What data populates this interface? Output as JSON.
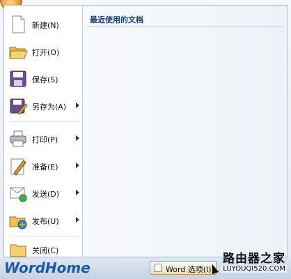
{
  "recent": {
    "title": "最近使用的文档"
  },
  "menu": {
    "items": [
      {
        "label": "新建(N)",
        "icon": "new-document-icon",
        "has_submenu": false
      },
      {
        "label": "打开(O)",
        "icon": "open-folder-icon",
        "has_submenu": false
      },
      {
        "label": "保存(S)",
        "icon": "save-disk-icon",
        "has_submenu": false
      },
      {
        "label": "另存为(A)",
        "icon": "save-as-icon",
        "has_submenu": true
      },
      {
        "label": "打印(P)",
        "icon": "printer-icon",
        "has_submenu": true
      },
      {
        "label": "准备(E)",
        "icon": "prepare-pen-icon",
        "has_submenu": true
      },
      {
        "label": "发送(D)",
        "icon": "send-mail-icon",
        "has_submenu": true
      },
      {
        "label": "发布(U)",
        "icon": "publish-icon",
        "has_submenu": true
      },
      {
        "label": "关闭(C)",
        "icon": "close-folder-icon",
        "has_submenu": false
      }
    ]
  },
  "footer": {
    "options_label": "Word 选项(I)"
  },
  "watermarks": {
    "left": "WordHome",
    "right_top": "路由器之家",
    "right_bottom": "LUYOUQI520.COM"
  },
  "colors": {
    "accent": "#1c5aa6",
    "panel_border": "#a9b8cc"
  }
}
